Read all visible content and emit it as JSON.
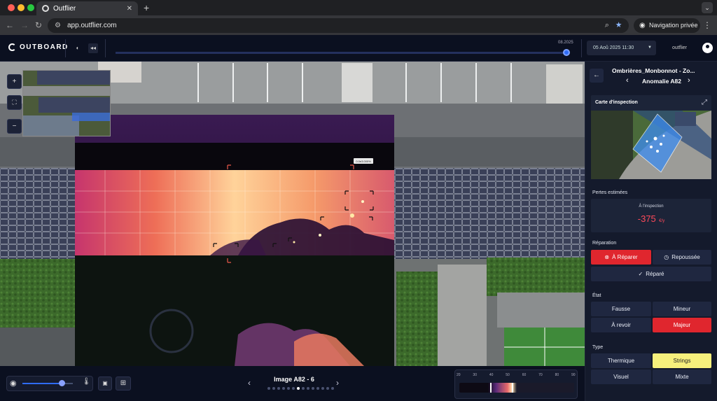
{
  "browser": {
    "tab_title": "Outflier",
    "url": "app.outflier.com",
    "private_label": "Navigation privée"
  },
  "app": {
    "logo_text": "OUTBOARD",
    "timeline_label": "08.2025",
    "date_value": "05 Aoû 2025 11:30",
    "account_name": "outflier"
  },
  "map": {
    "anomaly_tag": "0.0e3.000%"
  },
  "bottombar": {
    "image_title": "Image A82 - 6",
    "scale_ticks": [
      "20",
      "30",
      "40",
      "50",
      "60",
      "70",
      "80",
      "90"
    ],
    "thumbnail_count": 14,
    "current_thumbnail": 7,
    "slider_value": 0.78,
    "scale_selection": [
      0.27,
      0.47
    ]
  },
  "panel": {
    "site_name": "Ombrières_Monbonnot - Zo...",
    "anomaly_name": "Anomalie A82",
    "inspection_map_title": "Carte d'inspection",
    "losses_title": "Pertes estimées",
    "losses_caption": "À l'inspection",
    "losses_value": "-375",
    "losses_unit": "€/y",
    "repair_title": "Réparation",
    "repair_options": [
      "À Réparer",
      "Repoussée",
      "Réparé"
    ],
    "repair_selected": "À Réparer",
    "state_title": "État",
    "state_options": [
      "Fausse",
      "Mineur",
      "À revoir",
      "Majeur"
    ],
    "state_selected": "Majeur",
    "type_title": "Type",
    "type_options": [
      "Thermique",
      "Strings",
      "Visuel",
      "Mixte"
    ],
    "type_selected": "Strings"
  },
  "colors": {
    "accent_blue": "#2f6cf6",
    "selected_red": "#e0262e",
    "selected_yellow": "#f6f07c",
    "loss_red": "#ff4a5a"
  }
}
